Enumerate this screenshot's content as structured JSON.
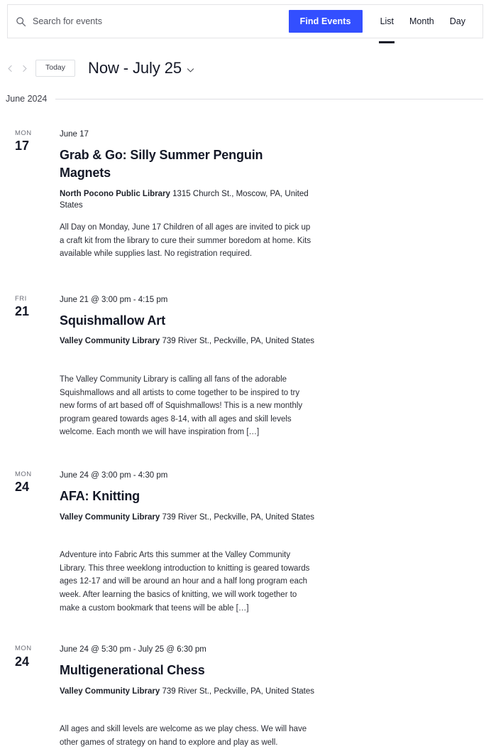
{
  "search": {
    "placeholder": "Search for events",
    "value": "",
    "icon": "search-icon",
    "find_events_label": "Find Events"
  },
  "view_tabs": [
    {
      "label": "List",
      "active": true
    },
    {
      "label": "Month",
      "active": false
    },
    {
      "label": "Day",
      "active": false
    }
  ],
  "date_nav": {
    "prev_icon": "chevron-left-icon",
    "next_icon": "chevron-right-icon",
    "today_label": "Today",
    "title": "Now - July 25",
    "caret_icon": "chevron-down-icon"
  },
  "month_separator": {
    "label": "June 2024"
  },
  "events": [
    {
      "dow": "MON",
      "dom": "17",
      "time": "June 17",
      "title": "Grab & Go: Silly Summer Penguin Magnets",
      "venue_name": "North Pocono Public Library",
      "venue_address": "1315 Church St., Moscow, PA, United States",
      "description": "All Day on Monday, June 17 Children of all ages are invited to pick up a craft kit from the library to cure their summer boredom at home. Kits available while supplies last. No registration required."
    },
    {
      "dow": "FRI",
      "dom": "21",
      "time": "June 21 @ 3:00 pm - 4:15 pm",
      "title": "Squishmallow Art",
      "venue_name": "Valley Community Library",
      "venue_address": "739 River St., Peckville, PA, United States",
      "description": "The Valley Community Library is calling all fans of the adorable Squishmallows and all artists to come together to be inspired to try new forms of art based off of Squishmallows! This is a new monthly program geared towards ages 8-14, with all ages and skill levels welcome. Each month we will have inspiration from […]"
    },
    {
      "dow": "MON",
      "dom": "24",
      "time": "June 24 @ 3:00 pm - 4:30 pm",
      "title": "AFA: Knitting",
      "venue_name": "Valley Community Library",
      "venue_address": "739 River St., Peckville, PA, United States",
      "description": "Adventure into Fabric Arts this summer at the Valley Community Library. This three weeklong introduction to knitting is geared towards ages 12-17 and will be around an hour and a half long program each week. After learning the basics of knitting, we will work together to make a custom bookmark that teens will be able […]"
    },
    {
      "dow": "MON",
      "dom": "24",
      "time": "June 24 @ 5:30 pm - July 25 @ 6:30 pm",
      "title": "Multigenerational Chess",
      "venue_name": "Valley Community Library",
      "venue_address": "739 River St., Peckville, PA, United States",
      "description": "All ages and skill levels are welcome as we play chess. We will have other games of strategy on hand to explore and play as well."
    }
  ],
  "colors": {
    "accent": "#334fff",
    "text": "#141827",
    "muted": "#6c6e77",
    "border": "#e4e4e7"
  }
}
